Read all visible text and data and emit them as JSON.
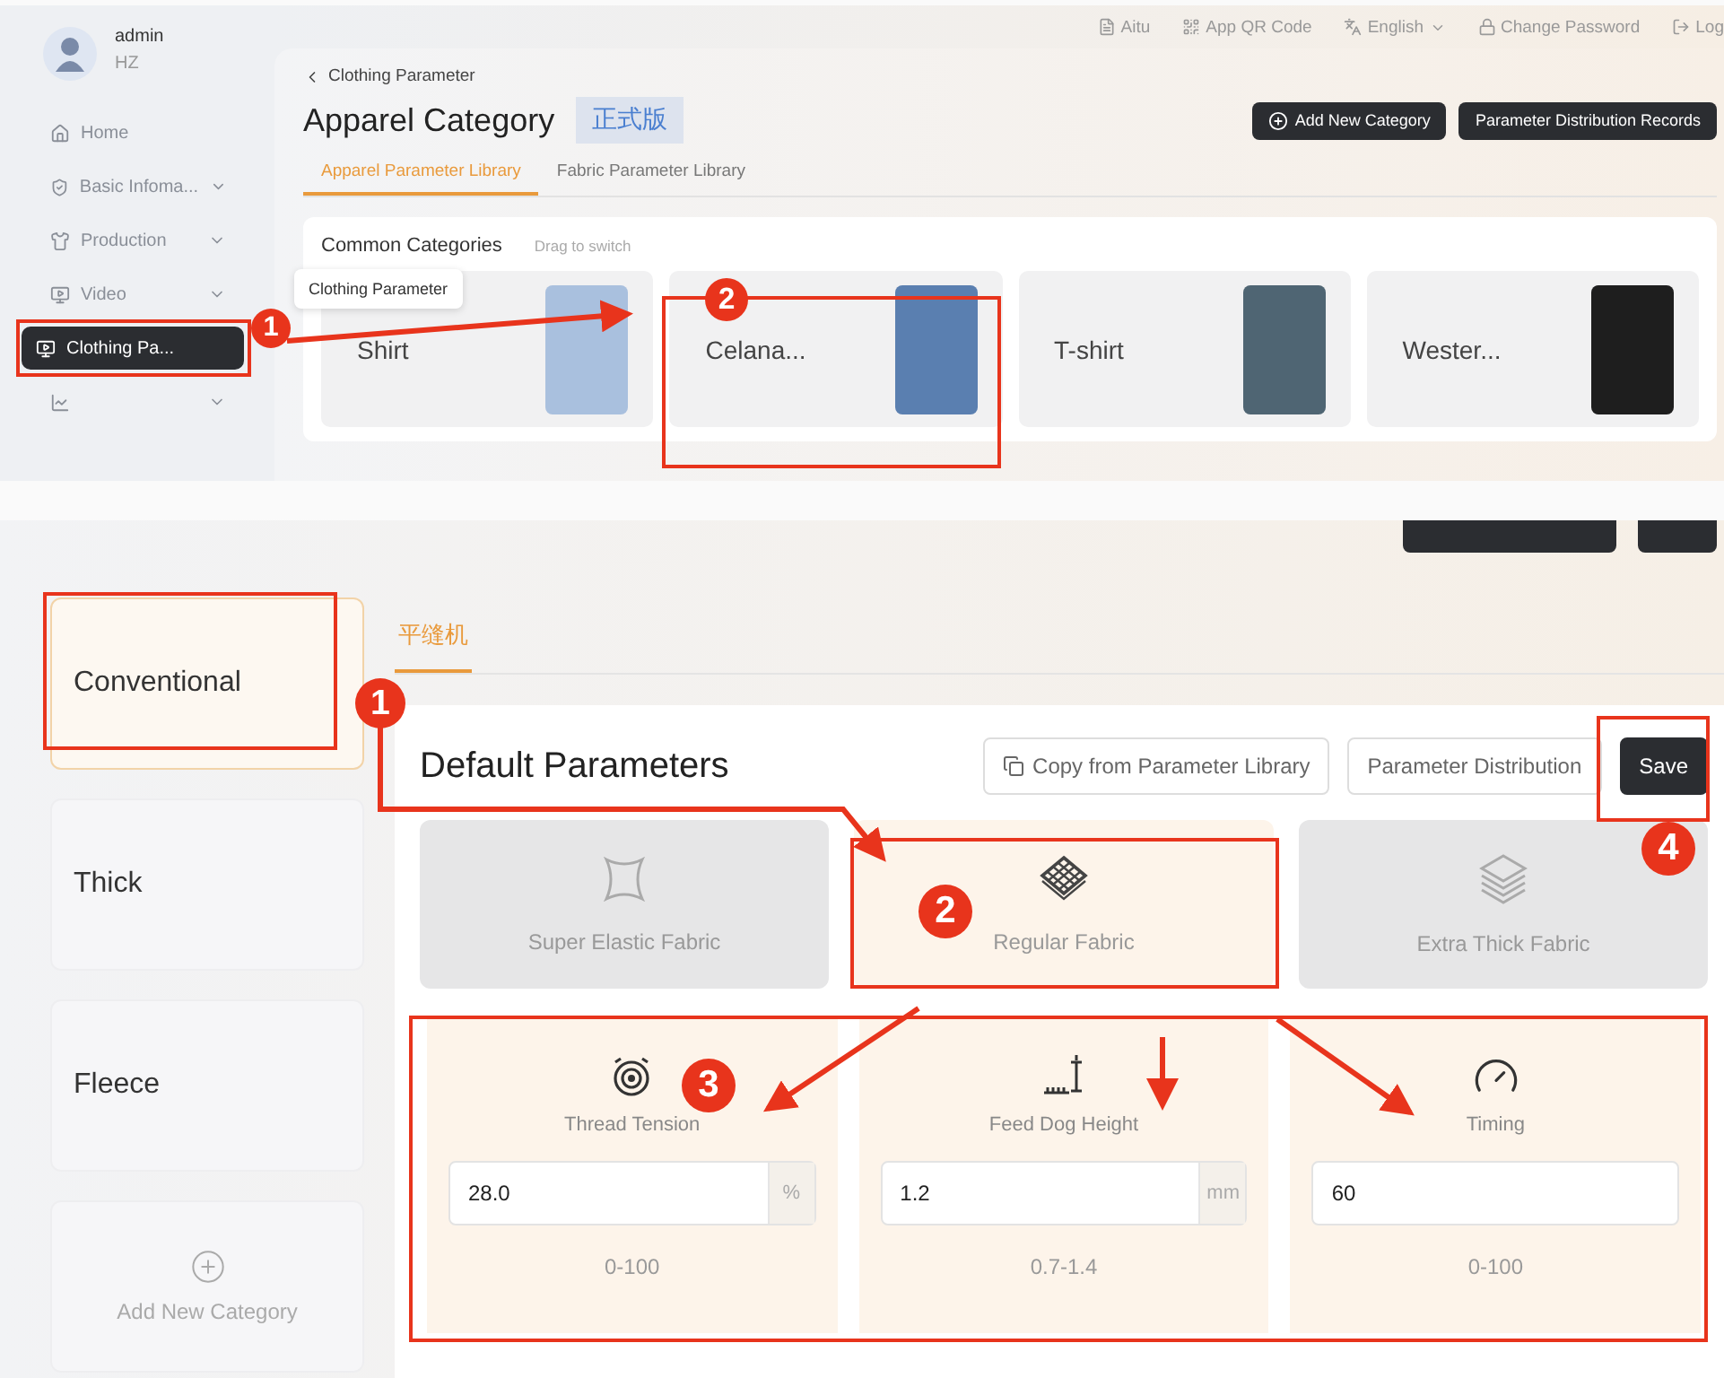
{
  "top_screen": {
    "user": {
      "name": "admin",
      "org": "HZ"
    },
    "nav": [
      {
        "label": "Home",
        "expandable": false,
        "selected": false
      },
      {
        "label": "Basic Infoma...",
        "expandable": true,
        "selected": false
      },
      {
        "label": "Production",
        "expandable": true,
        "selected": false
      },
      {
        "label": "Video",
        "expandable": true,
        "selected": false
      },
      {
        "label": "Clothing Pa...",
        "expandable": false,
        "selected": true
      },
      {
        "expandable": true,
        "selected": false
      }
    ],
    "tooltip": "Clothing Parameter",
    "header_links": [
      {
        "label": "Aitu",
        "dropdown": false
      },
      {
        "label": "App QR Code",
        "dropdown": false
      },
      {
        "label": "English",
        "dropdown": true
      },
      {
        "label": "Change Password",
        "dropdown": false
      },
      {
        "label": "Log",
        "dropdown": false
      }
    ],
    "breadcrumb": "Clothing Parameter",
    "title": "Apparel Category",
    "version_badge": "正式版",
    "actions": [
      "Add New Category",
      "Parameter Distribution Records"
    ],
    "tabs": [
      {
        "label": "Apparel Parameter Library",
        "selected": true
      },
      {
        "label": "Fabric Parameter Library",
        "selected": false
      }
    ],
    "common_categories": {
      "title": "Common Categories",
      "hint": "Drag to switch",
      "items": [
        {
          "label": "Shirt",
          "color": "#a9c0de"
        },
        {
          "label": "Celana...",
          "color": "#5a7fb0"
        },
        {
          "label": "T-shirt",
          "color": "#4f6573"
        },
        {
          "label": "Wester...",
          "color": "#1e1e1e"
        }
      ]
    },
    "annotation_markers": [
      "1",
      "2"
    ]
  },
  "bottom_screen": {
    "categories": [
      {
        "label": "Conventional",
        "selected": true
      },
      {
        "label": "Thick",
        "selected": false
      },
      {
        "label": "Fleece",
        "selected": false
      }
    ],
    "add_category": "Add New Category",
    "machine_tabs": [
      {
        "label": "平缝机",
        "selected": true
      }
    ],
    "panel": {
      "title": "Default Parameters",
      "actions": [
        {
          "label": "Copy from Parameter Library",
          "kind": "outline"
        },
        {
          "label": "Parameter Distribution",
          "kind": "outline"
        },
        {
          "label": "Save",
          "kind": "primary"
        }
      ],
      "fabrics": [
        {
          "label": "Super Elastic Fabric",
          "selected": false
        },
        {
          "label": "Regular Fabric",
          "selected": true
        },
        {
          "label": "Extra Thick Fabric",
          "selected": false
        }
      ],
      "params": [
        {
          "label": "Thread Tension",
          "value": "28.0",
          "unit": "%",
          "range": "0-100"
        },
        {
          "label": "Feed Dog Height",
          "value": "1.2",
          "unit": "mm",
          "range": "0.7-1.4"
        },
        {
          "label": "Timing",
          "value": "60",
          "range": "0-100"
        }
      ]
    },
    "annotation_markers": [
      "1",
      "2",
      "3",
      "4"
    ]
  }
}
